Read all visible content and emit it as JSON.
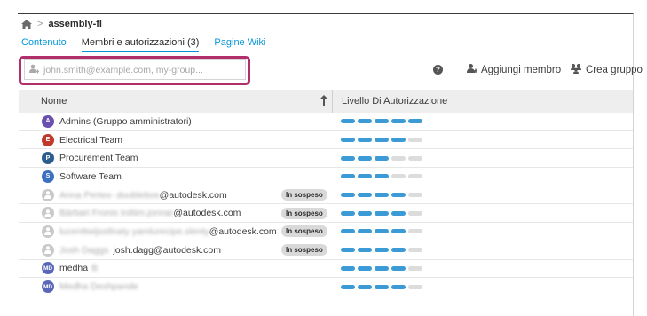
{
  "breadcrumb": {
    "title": "assembly-fl"
  },
  "tabs": [
    {
      "label": "Contenuto",
      "active": false
    },
    {
      "label": "Membri e autorizzazioni (3)",
      "active": true
    },
    {
      "label": "Pagine Wiki",
      "active": false
    }
  ],
  "search": {
    "placeholder": "john.smith@example.com, my-group..."
  },
  "actions": {
    "help": "?",
    "add_member": "Aggiungi membro",
    "create_group": "Crea gruppo"
  },
  "table": {
    "col_name": "Nome",
    "col_level": "Livello Di Autorizzazione",
    "pending_label": "In sospeso",
    "rows": [
      {
        "name": "Admins (Gruppo amministratori)",
        "avatar": "A",
        "avatar_color": "#6a4fb0",
        "level": 5
      },
      {
        "name": "Electrical Team",
        "avatar": "E",
        "avatar_color": "#c0392b",
        "level": 4
      },
      {
        "name": "Procurement Team",
        "avatar": "P",
        "avatar_color": "#2c5d8f",
        "level": 3
      },
      {
        "name": "Software Team",
        "avatar": "S",
        "avatar_color": "#3d6fc2",
        "level": 3
      },
      {
        "name_hidden": "Anna Pertes- doublebos",
        "name_visible": "@autodesk.com",
        "pending": true,
        "level": 4
      },
      {
        "name_hidden": "Bárbari Fronis Initiim.jonnar",
        "name_visible": "@autodesk.com",
        "pending": true,
        "level": 4
      },
      {
        "name_hidden": "lucenttwijsstlnaty yamlurecipe.slenty",
        "name_visible": "@autodesk.com",
        "pending": true,
        "level": 4
      },
      {
        "name_hidden": "Josh Daggs",
        "name_visible": "josh.dagg@autodesk.com",
        "pending": true,
        "level": 4
      },
      {
        "name": "medha",
        "name_hidden": "B",
        "avatar": "MD",
        "level": 4
      },
      {
        "name_hidden": "Medha Deshpande",
        "avatar": "MD",
        "level": 4
      }
    ]
  }
}
